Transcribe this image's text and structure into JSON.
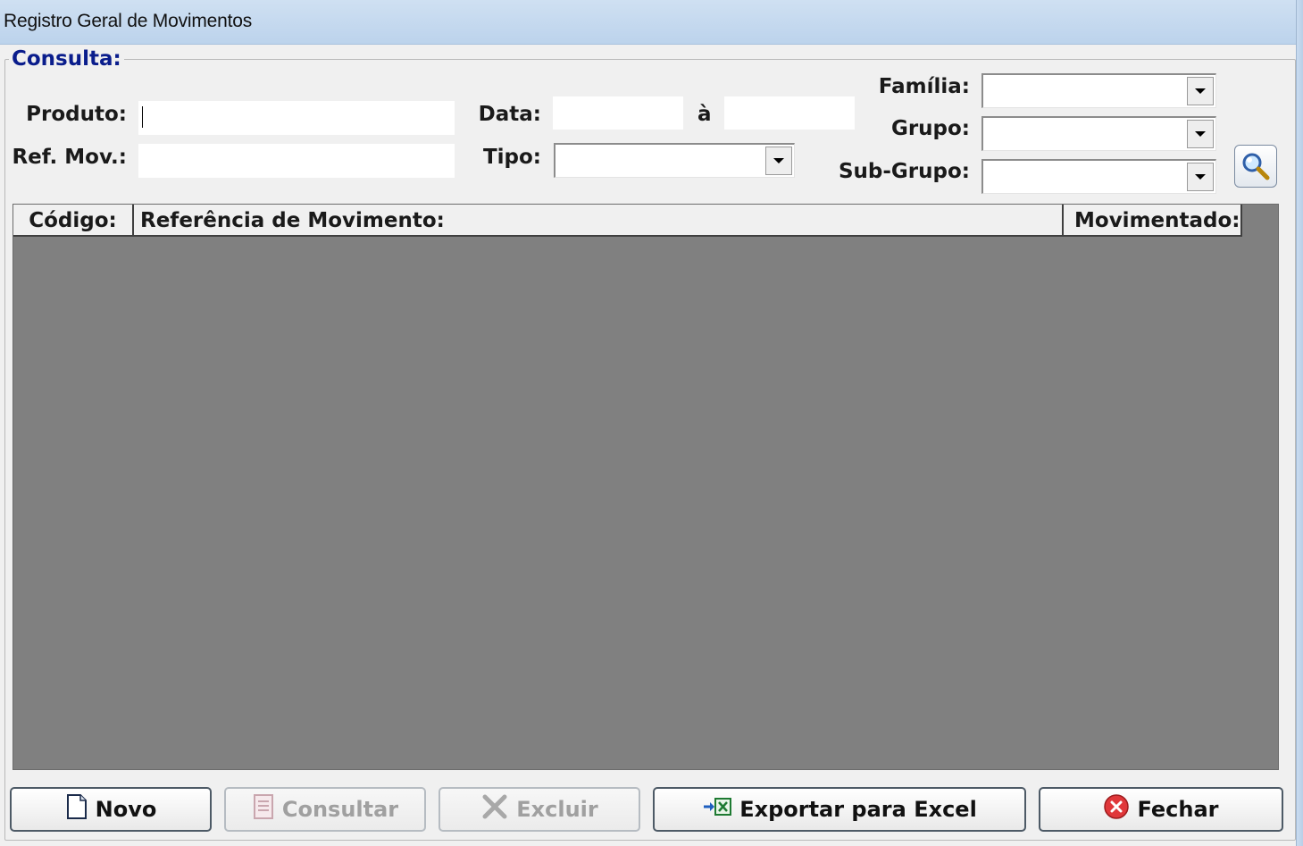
{
  "window": {
    "title": "Registro Geral de Movimentos"
  },
  "query": {
    "legend": "Consulta:",
    "produto": {
      "label": "Produto:",
      "value": ""
    },
    "ref_mov": {
      "label": "Ref. Mov.:",
      "value": ""
    },
    "data": {
      "label": "Data:",
      "from": "",
      "separator": "à",
      "to": ""
    },
    "tipo": {
      "label": "Tipo:",
      "selected": ""
    },
    "familia": {
      "label": "Família:",
      "selected": ""
    },
    "grupo": {
      "label": "Grupo:",
      "selected": ""
    },
    "subgrupo": {
      "label": "Sub-Grupo:",
      "selected": ""
    }
  },
  "grid": {
    "columns": [
      "Código:",
      "Referência de Movimento:",
      "Movimentado:"
    ],
    "rows": []
  },
  "buttons": {
    "novo": "Novo",
    "consultar": "Consultar",
    "excluir": "Excluir",
    "exportar": "Exportar para Excel",
    "fechar": "Fechar"
  },
  "colors": {
    "titlebar": "#bcd3ec",
    "legend_text": "#0a1d8c",
    "grid_background": "#808080"
  }
}
